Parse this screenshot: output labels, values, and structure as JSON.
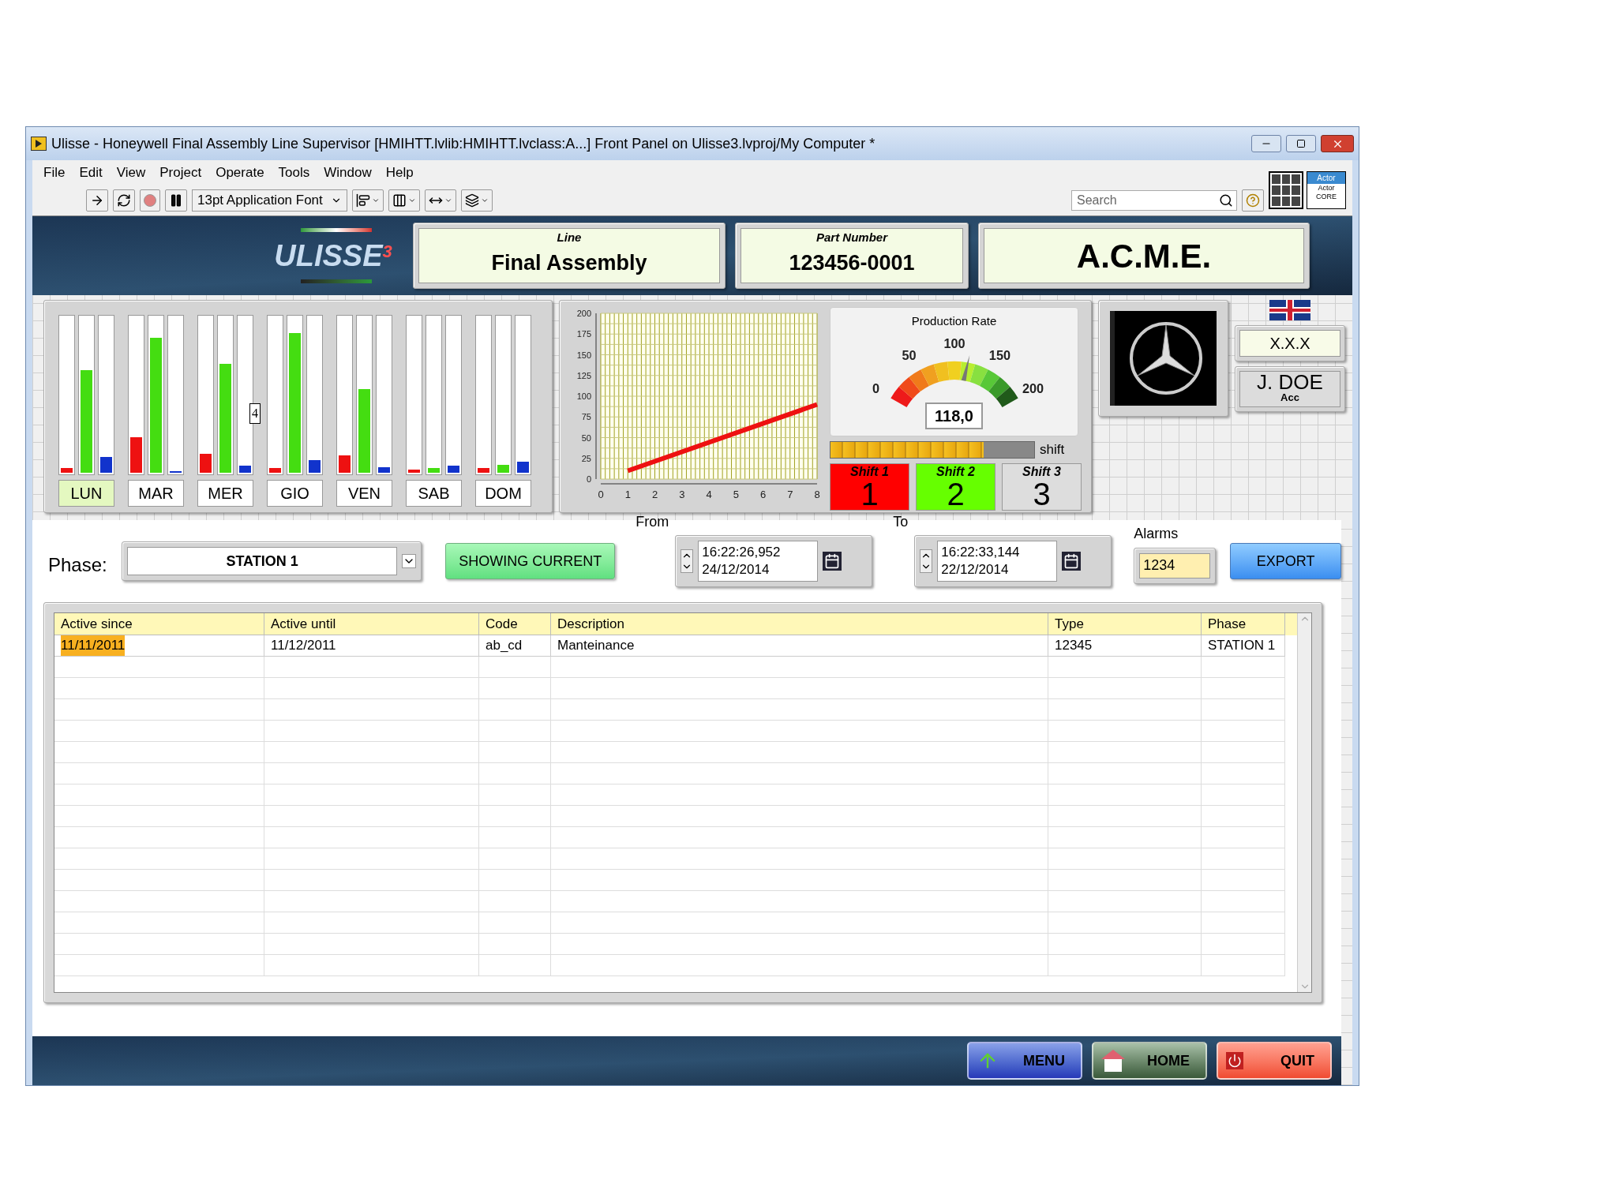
{
  "window": {
    "title": "Ulisse - Honeywell Final Assembly Line Supervisor [HMIHTT.lvlib:HMIHTT.lvclass:A...] Front Panel on Ulisse3.lvproj/My Computer *"
  },
  "menu": [
    "File",
    "Edit",
    "View",
    "Project",
    "Operate",
    "Tools",
    "Window",
    "Help"
  ],
  "toolbar": {
    "font": "13pt Application Font",
    "search": {
      "placeholder": "Search"
    },
    "actor": {
      "title": "Actor",
      "subtitle": "Actor CORE"
    }
  },
  "header": {
    "logo": "ULISSE$^{3}$",
    "line": {
      "label": "Line",
      "value": "Final Assembly"
    },
    "part_number": {
      "label": "Part Number",
      "value": "123456-0001"
    },
    "customer": "A.C.M.E."
  },
  "days": [
    {
      "label": "LUN",
      "selected": true,
      "bars": [
        {
          "color": "#ee1111",
          "level": 0.03
        },
        {
          "color": "#44dd11",
          "level": 0.66
        },
        {
          "color": "#1133cc",
          "level": 0.1
        }
      ]
    },
    {
      "label": "MAR",
      "selected": false,
      "bars": [
        {
          "color": "#ee1111",
          "level": 0.23
        },
        {
          "color": "#44dd11",
          "level": 0.87
        },
        {
          "color": "#1133cc",
          "level": 0.01
        }
      ]
    },
    {
      "label": "MER",
      "selected": false,
      "bars": [
        {
          "color": "#ee1111",
          "level": 0.12
        },
        {
          "color": "#44dd11",
          "level": 0.7
        },
        {
          "color": "#1133cc",
          "level": 0.045
        }
      ]
    },
    {
      "label": "GIO",
      "selected": false,
      "bars": [
        {
          "color": "#ee1111",
          "level": 0.03
        },
        {
          "color": "#44dd11",
          "level": 0.9
        },
        {
          "color": "#1133cc",
          "level": 0.08
        }
      ]
    },
    {
      "label": "VEN",
      "selected": false,
      "bars": [
        {
          "color": "#ee1111",
          "level": 0.11
        },
        {
          "color": "#44dd11",
          "level": 0.54
        },
        {
          "color": "#1133cc",
          "level": 0.035
        }
      ]
    },
    {
      "label": "SAB",
      "selected": false,
      "bars": [
        {
          "color": "#ee1111",
          "level": 0.02
        },
        {
          "color": "#44dd11",
          "level": 0.03
        },
        {
          "color": "#1133cc",
          "level": 0.045
        }
      ]
    },
    {
      "label": "DOM",
      "selected": false,
      "bars": [
        {
          "color": "#ee1111",
          "level": 0.03
        },
        {
          "color": "#44dd11",
          "level": 0.05
        },
        {
          "color": "#1133cc",
          "level": 0.07
        }
      ]
    }
  ],
  "bar_marker": "4",
  "trend": {
    "chart_data": {
      "type": "line",
      "grid": true,
      "x": [
        1,
        8
      ],
      "series": [
        {
          "color": "#ee1111",
          "values": [
            10,
            90
          ]
        }
      ],
      "xlim": [
        0,
        8
      ],
      "ylim": [
        0,
        200
      ],
      "xticks": [
        0,
        1,
        2,
        3,
        4,
        5,
        6,
        7,
        8
      ],
      "yticks": [
        0,
        25,
        50,
        75,
        100,
        125,
        150,
        175,
        200
      ]
    }
  },
  "gauge": {
    "title": "Production Rate",
    "ticks": [
      "0",
      "50",
      "100",
      "150",
      "200"
    ],
    "level": 0.59,
    "reading": "118,0"
  },
  "shift_progress": {
    "level": 0.75,
    "label": "shift"
  },
  "shifts": [
    {
      "label": "Shift 1",
      "number": "1",
      "color": "#ff0000"
    },
    {
      "label": "Shift 2",
      "number": "2",
      "color": "#66ff00"
    },
    {
      "label": "Shift 3",
      "number": "3",
      "color": "#dddddd"
    }
  ],
  "version": "X.X.X",
  "user": {
    "name": "J. DOE",
    "role": "Acc"
  },
  "filter": {
    "phase_label": "Phase:",
    "phase": "STATION 1",
    "mode_button": "SHOWING CURRENT",
    "from": {
      "label": "From",
      "time": "16:22:26,952",
      "date": "24/12/2014"
    },
    "to": {
      "label": "To",
      "time": "16:22:33,144",
      "date": "22/12/2014"
    },
    "alarms": {
      "label": "Alarms",
      "value": "1234"
    },
    "export": "EXPORT"
  },
  "table": {
    "columns": [
      "Active since",
      "Active until",
      "Code",
      "Description",
      "Type",
      "Phase"
    ],
    "rows": [
      {
        "cells": [
          {
            "text": "11/11/2011",
            "selected": true
          },
          {
            "text": "11/12/2011",
            "selected": false
          },
          {
            "text": "ab_cd",
            "selected": false
          },
          {
            "text": "Manteinance",
            "selected": false
          },
          {
            "text": "12345",
            "selected": false
          },
          {
            "text": "STATION 1",
            "selected": false
          }
        ]
      }
    ]
  },
  "footer_buttons": [
    {
      "label": "MENU",
      "kind": "menu"
    },
    {
      "label": "HOME",
      "kind": "home"
    },
    {
      "label": "QUIT",
      "kind": "quit"
    }
  ]
}
